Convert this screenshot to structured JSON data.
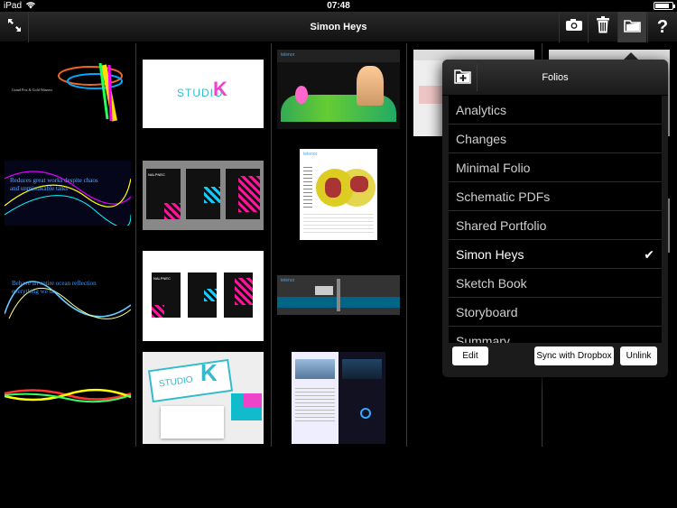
{
  "status_bar": {
    "carrier": "iPad",
    "time": "07:48",
    "battery_level": 0.85
  },
  "toolbar": {
    "title": "Simon Heys",
    "icons": [
      "expand-icon",
      "camera-icon",
      "trash-icon",
      "folder-icon",
      "help-icon"
    ]
  },
  "thumbnails": {
    "col1": [
      {
        "text": "Grand Prix & Gold Winners"
      },
      {
        "text": "Reduces great works despite chaos and unmistakable talks"
      },
      {
        "text": "Behave an entire ocean reflection everything we do."
      },
      {
        "text": ""
      }
    ],
    "col2": [
      {
        "brand": "STUDIO"
      },
      {
        "brand": "NALPNEC"
      },
      {
        "brand": "NALPNEC"
      },
      {
        "brand": "STUDIO"
      }
    ],
    "col3": [
      {
        "brand": "telenor"
      },
      {
        "brand": "telenor"
      },
      {
        "brand": "telenor"
      },
      {
        "brand": ""
      }
    ]
  },
  "folios_popover": {
    "title": "Folios",
    "items": [
      {
        "label": "Analytics",
        "selected": false
      },
      {
        "label": "Changes",
        "selected": false
      },
      {
        "label": "Minimal Folio",
        "selected": false
      },
      {
        "label": "Schematic PDFs",
        "selected": false
      },
      {
        "label": "Shared Portfolio",
        "selected": false
      },
      {
        "label": "Simon Heys",
        "selected": true
      },
      {
        "label": "Sketch Book",
        "selected": false
      },
      {
        "label": "Storyboard",
        "selected": false
      },
      {
        "label": "Summary",
        "selected": false
      }
    ],
    "checkmark": "✔",
    "edit_label": "Edit",
    "sync_label": "Sync with Dropbox",
    "unlink_label": "Unlink"
  }
}
